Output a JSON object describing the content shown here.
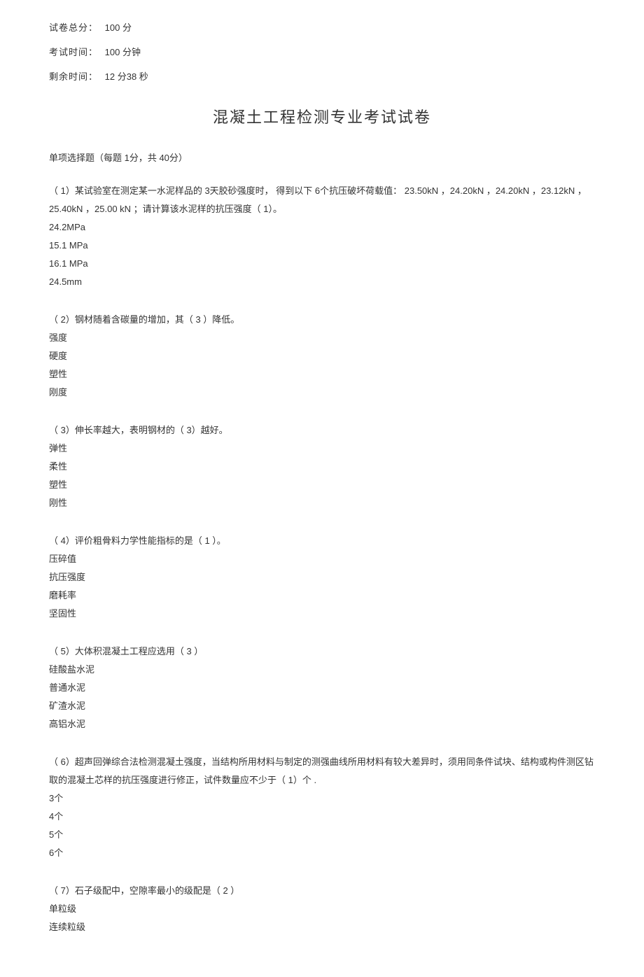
{
  "meta": {
    "totalScore": {
      "label": "试卷总分：",
      "value": "100  分"
    },
    "examTime": {
      "label": "考试时间：",
      "value": "100  分钟"
    },
    "remainTime": {
      "label": "剩余时间：",
      "value": "12  分38  秒"
    }
  },
  "title": "混凝土工程检测专业考试试卷",
  "sectionHeader": "单项选择题（每题   1分，共 40分）",
  "questions": [
    {
      "text": "（ 1）某试验室在测定某一水泥样品的     3天胶砂强度时，  得到以下 6个抗压破坏荷载值：   23.50kN ，24.20kN ，24.20kN ，23.12kN ，25.40kN ，25.00 kN  ；请计算该水泥样的抗压强度（     1）。",
      "options": [
        "24.2MPa",
        "15.1 MPa",
        "16.1 MPa",
        "24.5mm"
      ]
    },
    {
      "text": "（ 2）钢材随着含碳量的增加，其（     3  ）降低。",
      "options": [
        "强度",
        "硬度",
        "塑性",
        "刚度"
      ]
    },
    {
      "text": "（ 3）伸长率越大，表明钢材的（     3）越好。",
      "options": [
        "弹性",
        "柔性",
        "塑性",
        "刚性"
      ]
    },
    {
      "text": "（ 4）评价粗骨料力学性能指标的是（     1  ）。",
      "options": [
        "压碎值",
        "抗压强度",
        "磨耗率",
        "坚固性"
      ]
    },
    {
      "text": "（ 5）大体积混凝土工程应选用（     3  ）",
      "options": [
        "硅酸盐水泥",
        "普通水泥",
        "矿渣水泥",
        "高铝水泥"
      ]
    },
    {
      "text": "（ 6）超声回弹综合法检测混凝土强度，当结构所用材料与制定的测强曲线所用材料有较大差异时，须用同条件试块、结构或构件测区钻取的混凝土芯样的抗压强度进行修正，试件数量应不少于（         1）个 .",
      "options": [
        "3个",
        "4个",
        "5个",
        "6个"
      ]
    },
    {
      "text": "（ 7）石子级配中，空隙率最小的级配是（     2  ）",
      "options": [
        "单粒级",
        "连续粒级"
      ]
    }
  ]
}
